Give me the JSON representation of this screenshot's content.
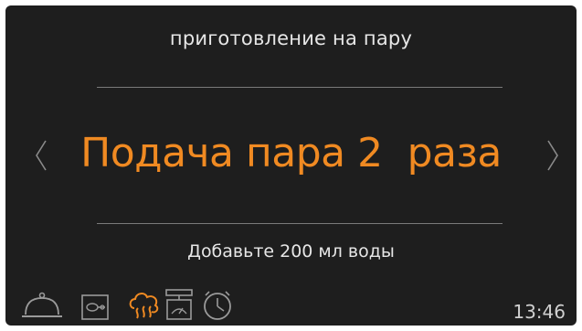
{
  "screen": {
    "mode_title": "приготовление на пару",
    "setting_value": "Подача пара 2  раза",
    "instruction": "Добавьте 200  мл воды",
    "clock": "13:46"
  },
  "colors": {
    "background": "#1e1e1e",
    "accent": "#f08a22",
    "text": "#e6e6e6",
    "icon_inactive": "#9a9a9a",
    "divider": "#7a7a7a"
  },
  "bottom_bar": {
    "icons": [
      {
        "name": "cloche-icon",
        "active": false
      },
      {
        "name": "food-probe-icon",
        "active": false
      },
      {
        "name": "steam-icon",
        "active": true
      },
      {
        "name": "weight-scale-icon",
        "active": false
      },
      {
        "name": "timer-icon",
        "active": false
      }
    ]
  }
}
